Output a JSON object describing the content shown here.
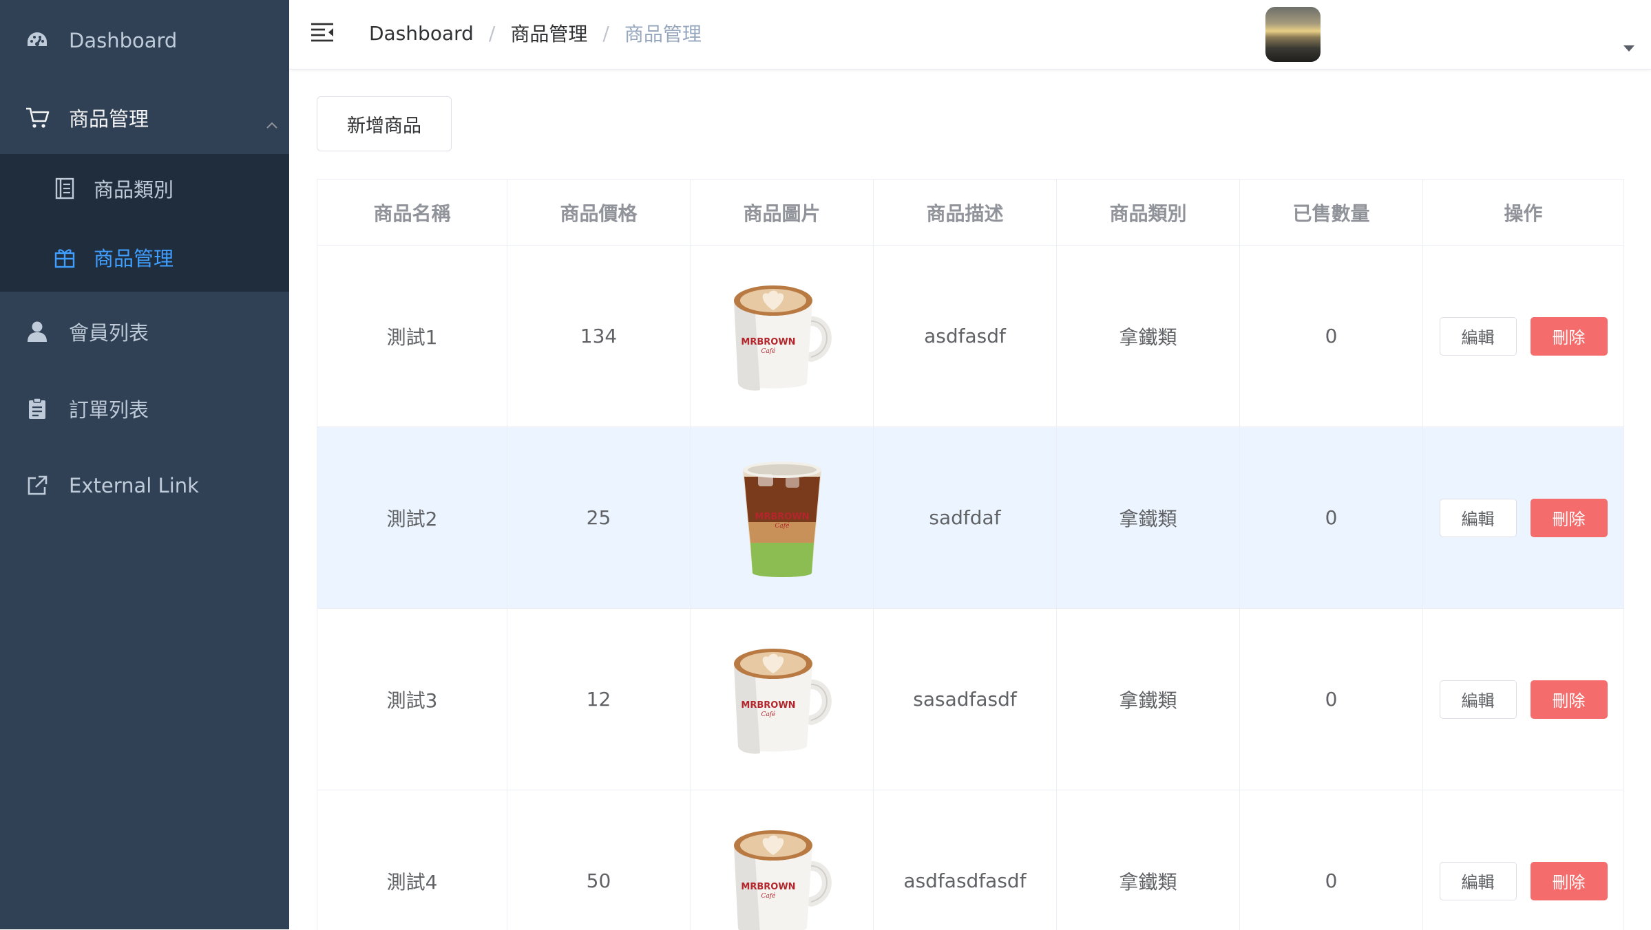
{
  "sidebar": {
    "dashboard": {
      "label": "Dashboard",
      "icon": "speedometer-icon"
    },
    "product_mgmt": {
      "label": "商品管理",
      "icon": "shopping-cart-icon"
    },
    "submenu": [
      {
        "label": "商品類別",
        "icon": "document-list-icon"
      },
      {
        "label": "商品管理",
        "icon": "gift-box-icon",
        "active": true
      }
    ],
    "members": {
      "label": "會員列表",
      "icon": "user-icon"
    },
    "orders": {
      "label": "訂單列表",
      "icon": "clipboard-icon"
    },
    "external": {
      "label": "External Link",
      "icon": "external-link-icon"
    }
  },
  "breadcrumb": [
    "Dashboard",
    "商品管理",
    "商品管理"
  ],
  "breadcrumb_separator": "/",
  "add_button_label": "新增商品",
  "table": {
    "headers": [
      "商品名稱",
      "商品價格",
      "商品圖片",
      "商品描述",
      "商品類別",
      "已售數量",
      "操作"
    ],
    "rows": [
      {
        "name": "測試1",
        "price": "134",
        "image": "hot-latte-mug",
        "description": "asdfasdf",
        "category": "拿鐵類",
        "sold": "0"
      },
      {
        "name": "測試2",
        "price": "25",
        "image": "iced-matcha-latte-cup",
        "description": "sadfdaf",
        "category": "拿鐵類",
        "sold": "0"
      },
      {
        "name": "測試3",
        "price": "12",
        "image": "hot-latte-mug",
        "description": "sasadfasdf",
        "category": "拿鐵類",
        "sold": "0"
      },
      {
        "name": "測試4",
        "price": "50",
        "image": "hot-latte-mug",
        "description": "asdfasdfasdf",
        "category": "拿鐵類",
        "sold": "0"
      }
    ],
    "edit_label": "編輯",
    "delete_label": "刪除",
    "cup_brand": "MRBROWN",
    "cup_sub": "Café"
  },
  "colors": {
    "sidebar_bg": "#304156",
    "submenu_bg": "#1f2d3d",
    "active": "#409eff",
    "danger": "#f56c6c",
    "row_highlight": "#ecf5ff"
  }
}
